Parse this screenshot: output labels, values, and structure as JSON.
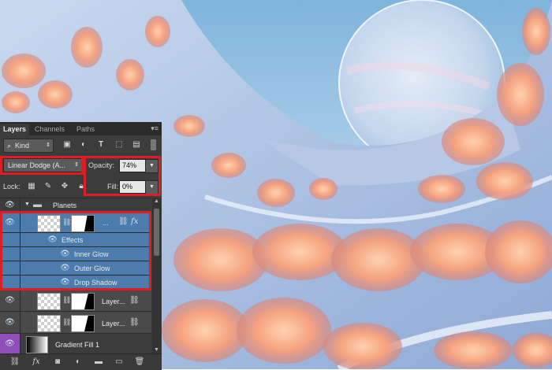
{
  "panel": {
    "tabs": [
      "Layers",
      "Channels",
      "Paths"
    ],
    "menu_icon": "panel-menu-icon",
    "filter": {
      "kind_label": "Kind"
    },
    "blend_mode": "Linear Dodge (A...",
    "opacity_label": "Opacity:",
    "opacity_value": "74%",
    "lock_label": "Lock:",
    "fill_label": "Fill:",
    "fill_value": "0%",
    "layers": [
      {
        "name": "Planets",
        "type": "group"
      },
      {
        "name": "...",
        "type": "layer",
        "selected": true
      },
      {
        "name": "Effects",
        "type": "effects-header"
      },
      {
        "name": "Inner Glow",
        "type": "effect"
      },
      {
        "name": "Outer Glow",
        "type": "effect"
      },
      {
        "name": "Drop Shadow",
        "type": "effect"
      },
      {
        "name": "Layer...",
        "type": "layer"
      },
      {
        "name": "Layer...",
        "type": "layer"
      },
      {
        "name": "Gradient Fill 1",
        "type": "fill"
      }
    ]
  },
  "colors": {
    "highlight": "#e11d24",
    "selected_row": "#4b7cab",
    "panel_bg": "#3c3c3c"
  }
}
